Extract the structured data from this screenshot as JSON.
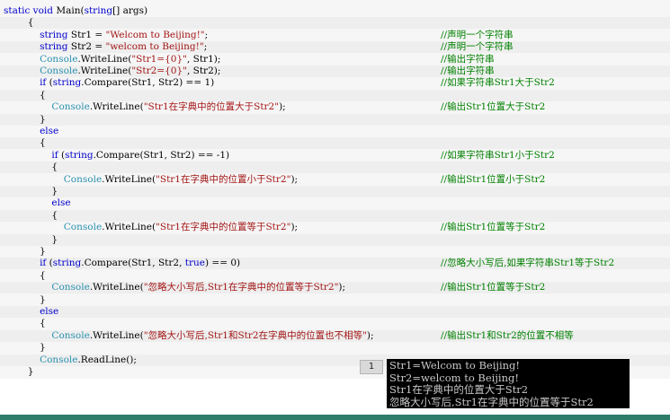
{
  "code": {
    "lines": [
      {
        "segs": [
          {
            "c": "kw",
            "t": "static void "
          },
          {
            "c": "",
            "t": "Main("
          },
          {
            "c": "kw",
            "t": "string"
          },
          {
            "c": "",
            "t": "[] args)"
          }
        ],
        "cmt": ""
      },
      {
        "segs": [
          {
            "c": "",
            "t": "        {"
          }
        ],
        "cmt": ""
      },
      {
        "segs": [
          {
            "c": "",
            "t": "            "
          },
          {
            "c": "kw",
            "t": "string"
          },
          {
            "c": "",
            "t": " Str1 = "
          },
          {
            "c": "st",
            "t": "\"Welcom to Beijing!\""
          },
          {
            "c": "",
            "t": ";"
          }
        ],
        "cmt": "//声明一个字符串"
      },
      {
        "segs": [
          {
            "c": "",
            "t": "            "
          },
          {
            "c": "kw",
            "t": "string"
          },
          {
            "c": "",
            "t": " Str2 = "
          },
          {
            "c": "st",
            "t": "\"welcom to Beijing!\""
          },
          {
            "c": "",
            "t": ";"
          }
        ],
        "cmt": "//声明一个字符串"
      },
      {
        "segs": [
          {
            "c": "",
            "t": "            "
          },
          {
            "c": "tp",
            "t": "Console"
          },
          {
            "c": "",
            "t": ".WriteLine("
          },
          {
            "c": "st",
            "t": "\"Str1={0}\""
          },
          {
            "c": "",
            "t": ", Str1);"
          }
        ],
        "cmt": "//输出字符串"
      },
      {
        "segs": [
          {
            "c": "",
            "t": "            "
          },
          {
            "c": "tp",
            "t": "Console"
          },
          {
            "c": "",
            "t": ".WriteLine("
          },
          {
            "c": "st",
            "t": "\"Str2={0}\""
          },
          {
            "c": "",
            "t": ", Str2);"
          }
        ],
        "cmt": "//输出字符串"
      },
      {
        "segs": [
          {
            "c": "",
            "t": "            "
          },
          {
            "c": "kw",
            "t": "if"
          },
          {
            "c": "",
            "t": " ("
          },
          {
            "c": "kw",
            "t": "string"
          },
          {
            "c": "",
            "t": ".Compare(Str1, Str2) == 1)"
          }
        ],
        "cmt": "//如果字符串Str1大于Str2"
      },
      {
        "segs": [
          {
            "c": "",
            "t": "            {"
          }
        ],
        "cmt": ""
      },
      {
        "segs": [
          {
            "c": "",
            "t": "                "
          },
          {
            "c": "tp",
            "t": "Console"
          },
          {
            "c": "",
            "t": ".WriteLine("
          },
          {
            "c": "st",
            "t": "\"Str1在字典中的位置大于Str2\""
          },
          {
            "c": "",
            "t": ");"
          }
        ],
        "cmt": "//输出Str1位置大于Str2"
      },
      {
        "segs": [
          {
            "c": "",
            "t": "            }"
          }
        ],
        "cmt": ""
      },
      {
        "segs": [
          {
            "c": "",
            "t": "            "
          },
          {
            "c": "kw",
            "t": "else"
          }
        ],
        "cmt": ""
      },
      {
        "segs": [
          {
            "c": "",
            "t": "            {"
          }
        ],
        "cmt": ""
      },
      {
        "segs": [
          {
            "c": "",
            "t": "                "
          },
          {
            "c": "kw",
            "t": "if"
          },
          {
            "c": "",
            "t": " ("
          },
          {
            "c": "kw",
            "t": "string"
          },
          {
            "c": "",
            "t": ".Compare(Str1, Str2) == -1)"
          }
        ],
        "cmt": "//如果字符串Str1小于Str2"
      },
      {
        "segs": [
          {
            "c": "",
            "t": "                {"
          }
        ],
        "cmt": ""
      },
      {
        "segs": [
          {
            "c": "",
            "t": "                    "
          },
          {
            "c": "tp",
            "t": "Console"
          },
          {
            "c": "",
            "t": ".WriteLine("
          },
          {
            "c": "st",
            "t": "\"Str1在字典中的位置小于Str2\""
          },
          {
            "c": "",
            "t": ");"
          }
        ],
        "cmt": "//输出Str1位置小于Str2"
      },
      {
        "segs": [
          {
            "c": "",
            "t": "                }"
          }
        ],
        "cmt": ""
      },
      {
        "segs": [
          {
            "c": "",
            "t": "                "
          },
          {
            "c": "kw",
            "t": "else"
          }
        ],
        "cmt": ""
      },
      {
        "segs": [
          {
            "c": "",
            "t": "                {"
          }
        ],
        "cmt": ""
      },
      {
        "segs": [
          {
            "c": "",
            "t": "                    "
          },
          {
            "c": "tp",
            "t": "Console"
          },
          {
            "c": "",
            "t": ".WriteLine("
          },
          {
            "c": "st",
            "t": "\"Str1在字典中的位置等于Str2\""
          },
          {
            "c": "",
            "t": ");"
          }
        ],
        "cmt": "//输出Str1位置等于Str2"
      },
      {
        "segs": [
          {
            "c": "",
            "t": "                }"
          }
        ],
        "cmt": ""
      },
      {
        "segs": [
          {
            "c": "",
            "t": "            }"
          }
        ],
        "cmt": ""
      },
      {
        "segs": [
          {
            "c": "",
            "t": "            "
          },
          {
            "c": "kw",
            "t": "if"
          },
          {
            "c": "",
            "t": " ("
          },
          {
            "c": "kw",
            "t": "string"
          },
          {
            "c": "",
            "t": ".Compare(Str1, Str2, "
          },
          {
            "c": "kw",
            "t": "true"
          },
          {
            "c": "",
            "t": ") == 0)"
          }
        ],
        "cmt": "//忽略大小写后,如果字符串Str1等于Str2"
      },
      {
        "segs": [
          {
            "c": "",
            "t": "            {"
          }
        ],
        "cmt": ""
      },
      {
        "segs": [
          {
            "c": "",
            "t": "                "
          },
          {
            "c": "tp",
            "t": "Console"
          },
          {
            "c": "",
            "t": ".WriteLine("
          },
          {
            "c": "st",
            "t": "\"忽略大小写后,Str1在字典中的位置等于Str2\""
          },
          {
            "c": "",
            "t": ");"
          }
        ],
        "cmt": "//输出Str1位置等于Str2"
      },
      {
        "segs": [
          {
            "c": "",
            "t": "            }"
          }
        ],
        "cmt": ""
      },
      {
        "segs": [
          {
            "c": "",
            "t": "            "
          },
          {
            "c": "kw",
            "t": "else"
          }
        ],
        "cmt": ""
      },
      {
        "segs": [
          {
            "c": "",
            "t": "            {"
          }
        ],
        "cmt": ""
      },
      {
        "segs": [
          {
            "c": "",
            "t": "                "
          },
          {
            "c": "tp",
            "t": "Console"
          },
          {
            "c": "",
            "t": ".WriteLine("
          },
          {
            "c": "st",
            "t": "\"忽略大小写后,Str1和Str2在字典中的位置也不相等\""
          },
          {
            "c": "",
            "t": ");"
          }
        ],
        "cmt": "//输出Str1和Str2的位置不相等"
      },
      {
        "segs": [
          {
            "c": "",
            "t": "            }"
          }
        ],
        "cmt": ""
      },
      {
        "segs": [
          {
            "c": "",
            "t": "            "
          },
          {
            "c": "tp",
            "t": "Console"
          },
          {
            "c": "",
            "t": ".ReadLine();"
          }
        ],
        "cmt": ""
      },
      {
        "segs": [
          {
            "c": "",
            "t": "        }"
          }
        ],
        "cmt": ""
      }
    ]
  },
  "badge": {
    "label": "1"
  },
  "console": {
    "lines": [
      "Str1=Welcom to Beijing!",
      "Str2=welcom to Beijing!",
      "Str1在字典中的位置大于Str2",
      "忽略大小写后,Str1在字典中的位置等于Str2"
    ]
  },
  "colors": {
    "keyword": "#0000cc",
    "type": "#2b91af",
    "string": "#a31515",
    "comment": "#008000",
    "console_bg": "#000000",
    "accent_bar": "#2e7d6a"
  }
}
